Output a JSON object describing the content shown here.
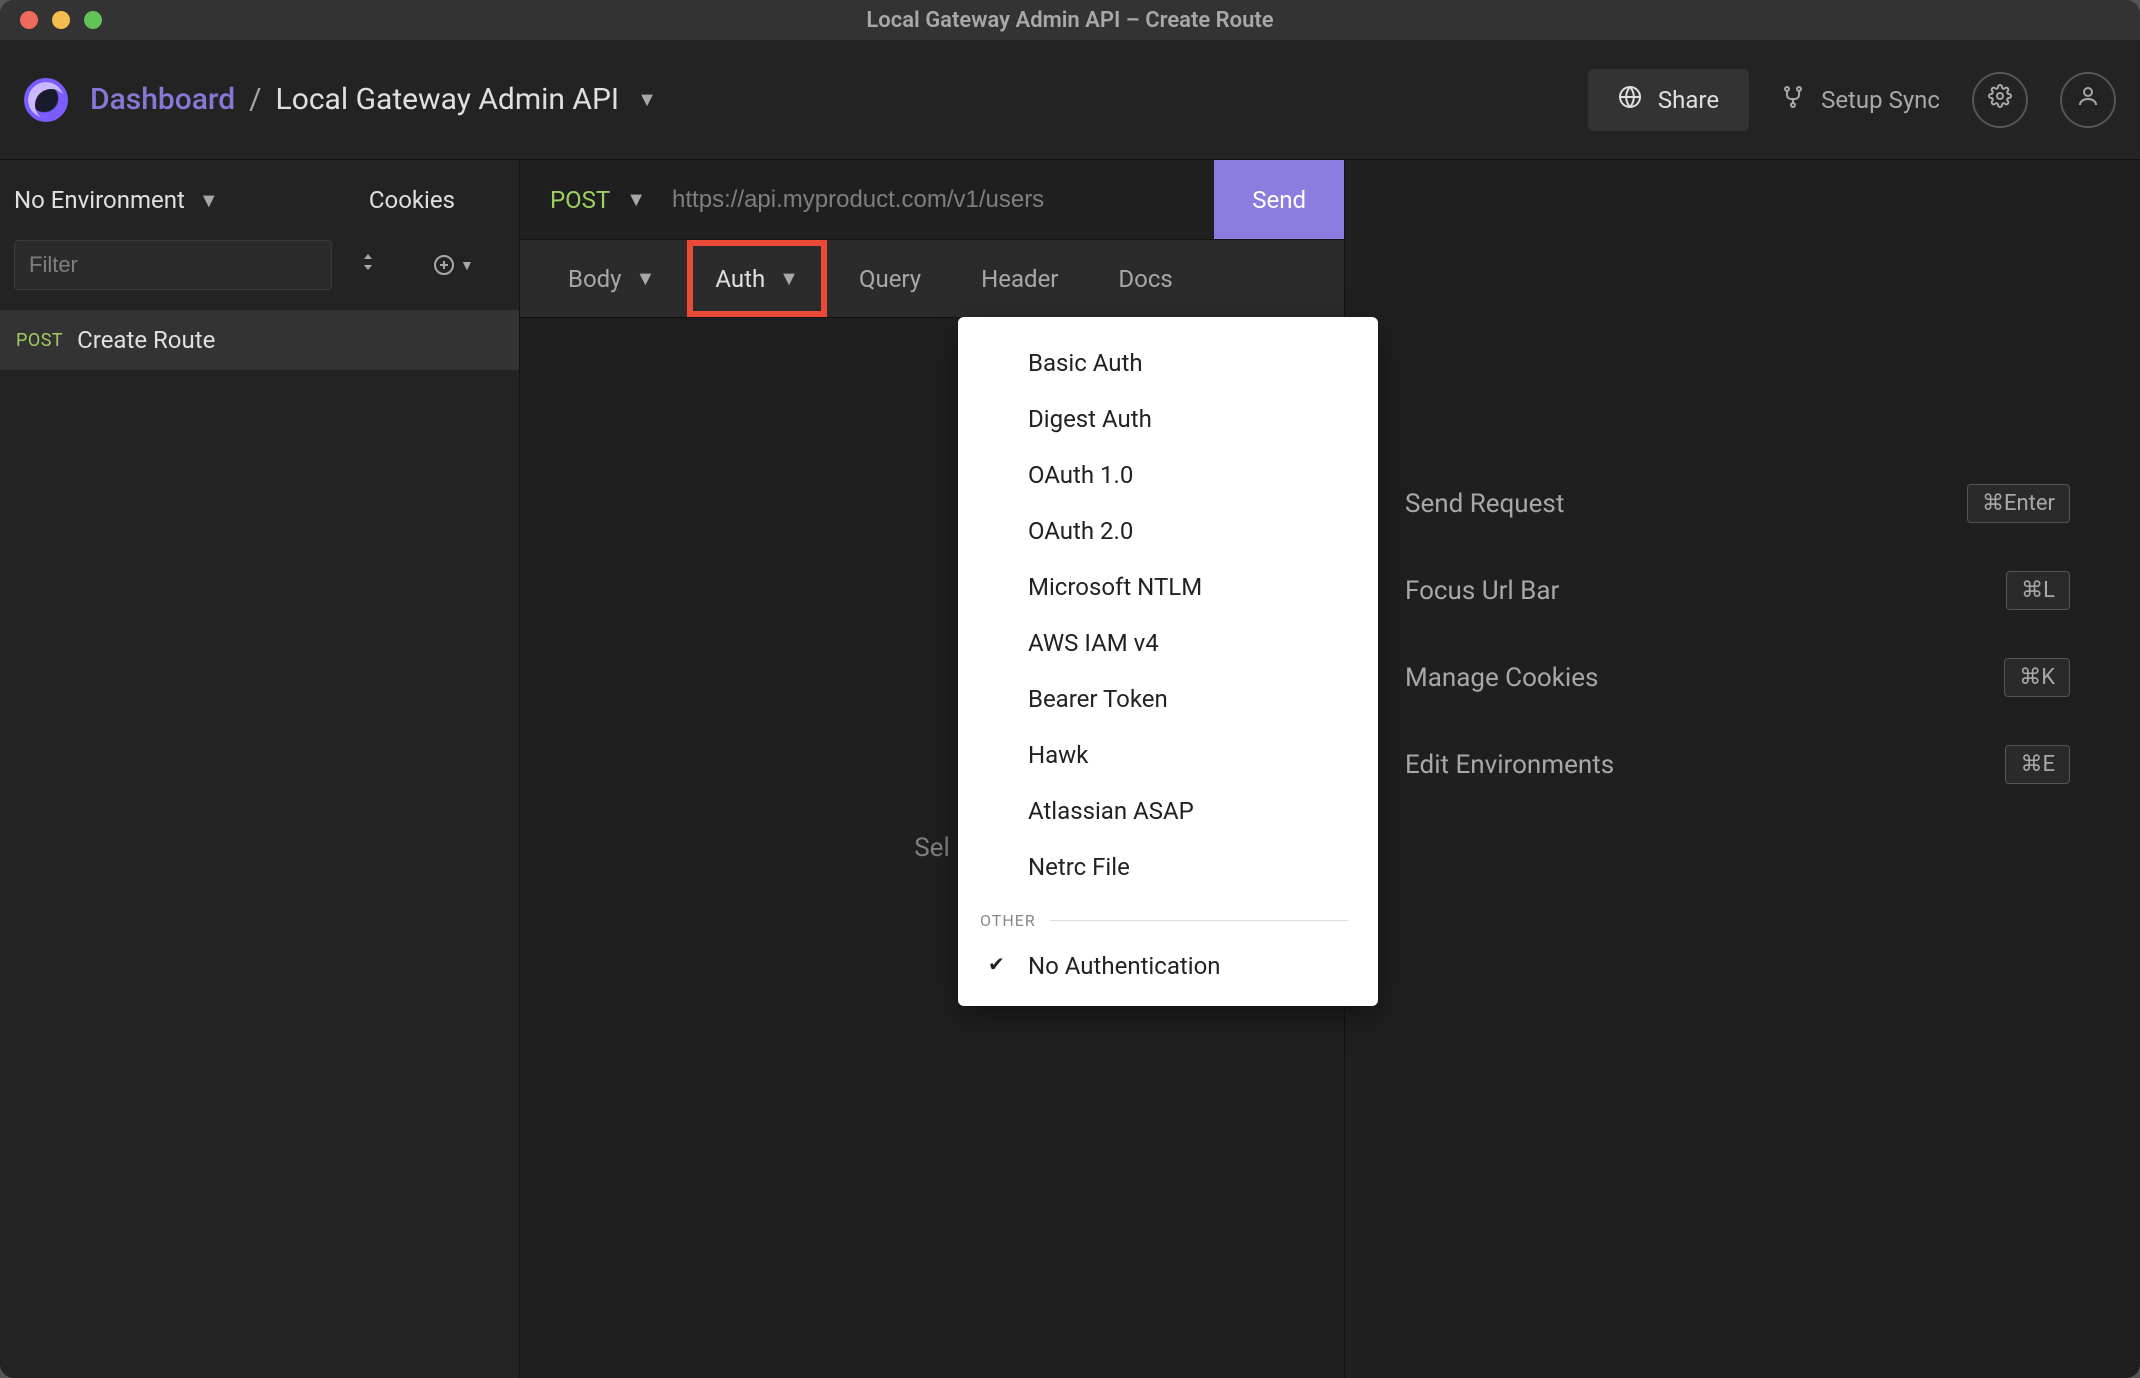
{
  "window": {
    "title": "Local Gateway Admin API – Create Route"
  },
  "topnav": {
    "dashboard": "Dashboard",
    "separator": "/",
    "project": "Local Gateway Admin API",
    "share": "Share",
    "setup_sync": "Setup Sync"
  },
  "sidebar": {
    "environment": "No Environment",
    "cookies": "Cookies",
    "filter_placeholder": "Filter",
    "items": [
      {
        "method": "POST",
        "name": "Create Route"
      }
    ]
  },
  "request": {
    "method": "POST",
    "url_placeholder": "https://api.myproduct.com/v1/users",
    "send": "Send",
    "tabs": {
      "body": "Body",
      "auth": "Auth",
      "query": "Query",
      "header": "Header",
      "docs": "Docs"
    },
    "body_hint_partial": "Sel"
  },
  "auth_menu": {
    "items": [
      "Basic Auth",
      "Digest Auth",
      "OAuth 1.0",
      "OAuth 2.0",
      "Microsoft NTLM",
      "AWS IAM v4",
      "Bearer Token",
      "Hawk",
      "Atlassian ASAP",
      "Netrc File"
    ],
    "section_other": "OTHER",
    "no_auth": "No Authentication"
  },
  "shortcuts": [
    {
      "label": "Send Request",
      "key": "⌘Enter"
    },
    {
      "label": "Focus Url Bar",
      "key": "⌘L"
    },
    {
      "label": "Manage Cookies",
      "key": "⌘K"
    },
    {
      "label": "Edit Environments",
      "key": "⌘E"
    }
  ]
}
